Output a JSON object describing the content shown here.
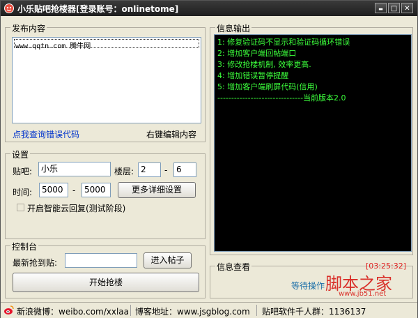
{
  "window": {
    "title": "小乐贴吧抢楼器[登录账号：onlinetome]",
    "controls": {
      "minimize": "▬",
      "restore": "□",
      "close": "✕"
    }
  },
  "publish": {
    "group_title": "发布内容",
    "content": "www.qqtn.com  腾牛网",
    "query_link": "点我查询错误代码",
    "edit_hint": "右键编辑内容"
  },
  "settings": {
    "group_title": "设置",
    "tieba_label": "贴吧:",
    "tieba_value": "小乐",
    "floor_label": "楼层:",
    "floor_from": "2",
    "floor_dash": "-",
    "floor_to": "6",
    "time_label": "时间:",
    "time_from": "5000",
    "time_dash": "-",
    "time_to": "5000",
    "more_button": "更多详细设置",
    "smart_reply_label": "开启智能云回复(测试阶段)",
    "smart_reply_checked": false
  },
  "console_group": {
    "group_title": "控制台",
    "latest_label": "最新抢到贴:",
    "latest_value": "",
    "enter_button": "进入帖子",
    "start_button": "开始抢楼"
  },
  "info_output": {
    "group_title": "信息输出",
    "lines": [
      "1: 修复验证码不显示和验证码循环错误",
      "2: 增加客户端回帖端口",
      "3: 修改抢楼机制, 效率更高.",
      "4: 增加错误暂停提醒",
      "5: 增加客户端刷屏代码(信用)",
      "-------------------------------当前版本2.0"
    ],
    "text_color": "#3cff3c",
    "background": "#000000"
  },
  "info_view": {
    "group_title": "信息查看",
    "timer": "[03:25:32]",
    "status": "等待操作",
    "timer_color": "#e02020",
    "status_color": "#1a6ea8"
  },
  "statusbar": {
    "weibo": "新浪微博：weibo.com/xxlaa",
    "blog": "博客地址：www.jsgblog.com",
    "group": "贴吧软件千人群：1136137"
  },
  "watermark": {
    "text": "脚本之家",
    "url": "www.jb51.net",
    "color": "#d9302a"
  }
}
